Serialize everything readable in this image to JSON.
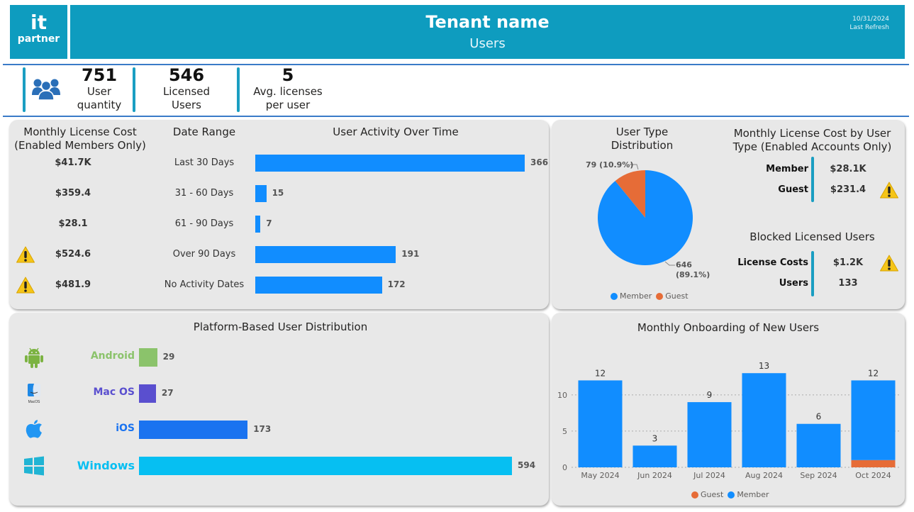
{
  "header": {
    "logo_line1": "it",
    "logo_line2": "partner",
    "title": "Tenant name",
    "subtitle": "Users",
    "refresh_date": "10/31/2024",
    "refresh_label": "Last Refresh"
  },
  "kpis": [
    {
      "value": "751",
      "label1": "User",
      "label2": "quantity",
      "icon": "users-group-icon"
    },
    {
      "value": "546",
      "label1": "Licensed",
      "label2": "Users"
    },
    {
      "value": "5",
      "label1": "Avg. licenses",
      "label2": "per user"
    }
  ],
  "activity": {
    "cost_title1": "Monthly License Cost",
    "cost_title2": "(Enabled Members Only)",
    "range_title": "Date Range",
    "chart_title": "User Activity Over Time",
    "rows": [
      {
        "cost": "$41.7K",
        "range": "Last 30 Days",
        "users": 366,
        "label": "366",
        "warning": false
      },
      {
        "cost": "$359.4",
        "range": "31 - 60 Days",
        "users": 15,
        "label": "15",
        "warning": false
      },
      {
        "cost": "$28.1",
        "range": "61 - 90 Days",
        "users": 7,
        "label": "7",
        "warning": false
      },
      {
        "cost": "$524.6",
        "range": "Over 90 Days",
        "users": 191,
        "label": "191",
        "warning": true
      },
      {
        "cost": "$481.9",
        "range": "No Activity Dates",
        "users": 172,
        "label": "172",
        "warning": true
      }
    ],
    "bar_color": "#118dff"
  },
  "user_type": {
    "title1": "User Type",
    "title2": "Distribution",
    "guest_label": "79 (10.9%)",
    "member_label1": "646",
    "member_label2": "(89.1%)",
    "legend": [
      "Member",
      "Guest"
    ],
    "colors": {
      "member": "#118dff",
      "guest": "#e66c37"
    }
  },
  "cost_by_type": {
    "title1": "Monthly License Cost by User",
    "title2": "Type (Enabled Accounts Only)",
    "rows": [
      {
        "label": "Member",
        "value": "$28.1K",
        "warning": false
      },
      {
        "label": "Guest",
        "value": "$231.4",
        "warning": true
      }
    ]
  },
  "blocked": {
    "title": "Blocked Licensed Users",
    "rows": [
      {
        "label": "License Costs",
        "value": "$1.2K",
        "warning": true
      },
      {
        "label": "Users",
        "value": "133",
        "warning": false
      }
    ]
  },
  "platform": {
    "title": "Platform-Based User Distribution",
    "rows": [
      {
        "name": "Android",
        "value": 29,
        "label": "29",
        "color": "#8bc36b",
        "icon": "android-icon"
      },
      {
        "name": "Mac OS",
        "value": 27,
        "label": "27",
        "color": "#5a4fcf",
        "icon": "macos-finder-icon"
      },
      {
        "name": "iOS",
        "value": 173,
        "label": "173",
        "color": "#1a73f0",
        "icon": "apple-icon"
      },
      {
        "name": "Windows",
        "value": 594,
        "label": "594",
        "color": "#06bff2",
        "icon": "windows-icon"
      }
    ],
    "macos_caption": "MacOS"
  },
  "chart_data": [
    {
      "type": "bar",
      "title": "User Activity Over Time",
      "orientation": "horizontal",
      "categories": [
        "Last 30 Days",
        "31 - 60 Days",
        "61 - 90 Days",
        "Over 90 Days",
        "No Activity Dates"
      ],
      "values": [
        366,
        15,
        7,
        191,
        172
      ]
    },
    {
      "type": "pie",
      "title": "User Type Distribution",
      "categories": [
        "Member",
        "Guest"
      ],
      "values": [
        646,
        79
      ],
      "percentages": [
        89.1,
        10.9
      ],
      "legend": "bottom"
    },
    {
      "type": "bar",
      "title": "Platform-Based User Distribution",
      "orientation": "horizontal",
      "categories": [
        "Android",
        "Mac OS",
        "iOS",
        "Windows"
      ],
      "values": [
        29,
        27,
        173,
        594
      ]
    },
    {
      "type": "bar",
      "stacked": true,
      "title": "Monthly Onboarding of New Users",
      "categories": [
        "May 2024",
        "Jun 2024",
        "Jul 2024",
        "Aug 2024",
        "Sep 2024",
        "Oct 2024"
      ],
      "series": [
        {
          "name": "Guest",
          "values": [
            0,
            0,
            0,
            0,
            0,
            1
          ],
          "color": "#e66c37"
        },
        {
          "name": "Member",
          "values": [
            12,
            3,
            9,
            13,
            6,
            11
          ],
          "color": "#118dff"
        }
      ],
      "totals": [
        12,
        3,
        9,
        13,
        6,
        12
      ],
      "yticks": [
        0,
        5,
        10
      ],
      "ylim": [
        0,
        14
      ],
      "grid": true,
      "legend": "bottom"
    }
  ]
}
